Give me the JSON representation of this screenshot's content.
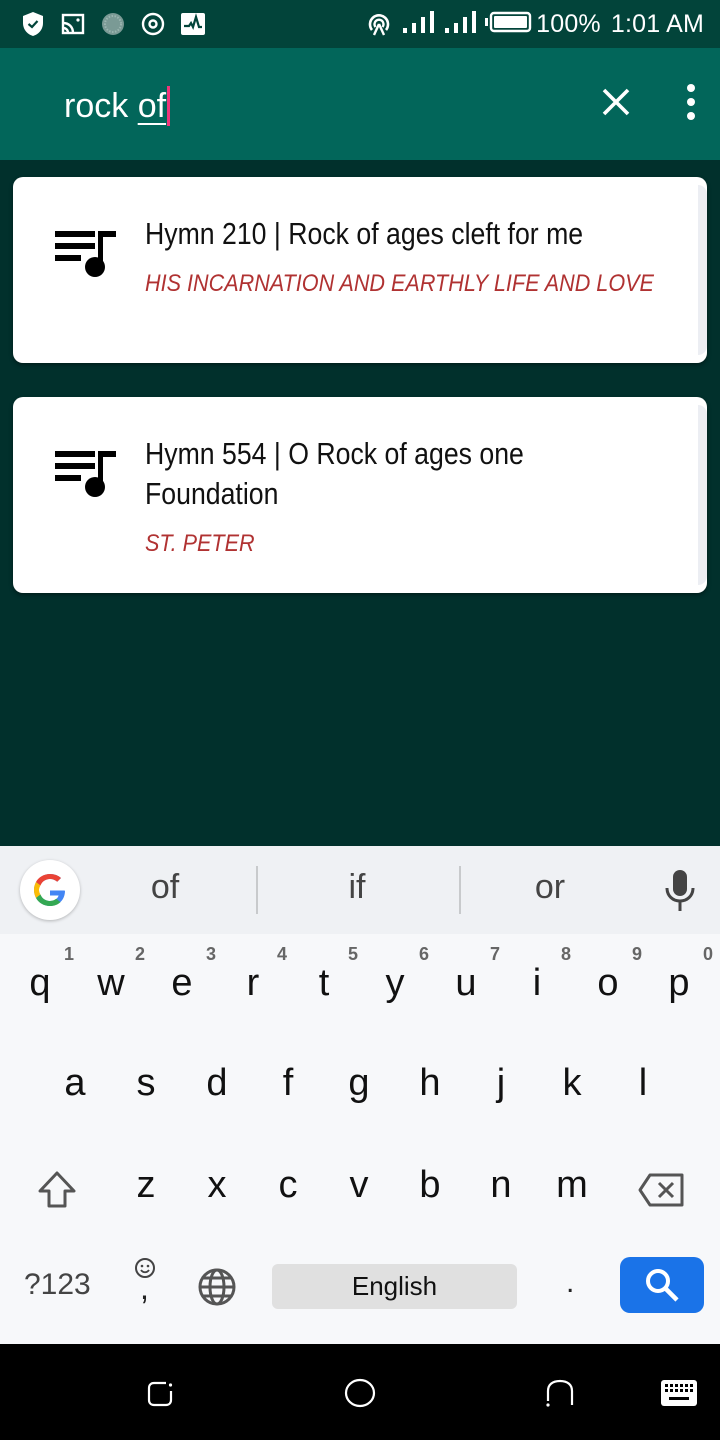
{
  "status_bar": {
    "left_icons": [
      "shield-check-icon",
      "cast-icon",
      "loading-icon",
      "target-icon",
      "activity-icon"
    ],
    "right_icons": [
      "hotspot-icon",
      "signal-icon",
      "signal-icon",
      "battery-icon"
    ],
    "battery": "100%",
    "time": "1:01 AM"
  },
  "search": {
    "query_prefix": "rock ",
    "query_composing": "of",
    "clear_icon": "close-icon",
    "menu_icon": "more-vert-icon"
  },
  "results": [
    {
      "icon": "music-queue-icon",
      "title": "Hymn 210 |  Rock of ages cleft for me",
      "subtitle": "HIS INCARNATION AND EARTHLY LIFE AND LOVE"
    },
    {
      "icon": "music-queue-icon",
      "title": "Hymn 554 | O Rock of ages one Foundation",
      "subtitle": "ST. PETER"
    }
  ],
  "keyboard": {
    "suggestions": [
      "of",
      "if",
      "or"
    ],
    "row1": [
      {
        "key": "q",
        "num": "1"
      },
      {
        "key": "w",
        "num": "2"
      },
      {
        "key": "e",
        "num": "3"
      },
      {
        "key": "r",
        "num": "4"
      },
      {
        "key": "t",
        "num": "5"
      },
      {
        "key": "y",
        "num": "6"
      },
      {
        "key": "u",
        "num": "7"
      },
      {
        "key": "i",
        "num": "8"
      },
      {
        "key": "o",
        "num": "9"
      },
      {
        "key": "p",
        "num": "0"
      }
    ],
    "row2": [
      "a",
      "s",
      "d",
      "f",
      "g",
      "h",
      "j",
      "k",
      "l"
    ],
    "row3": [
      "z",
      "x",
      "c",
      "v",
      "b",
      "n",
      "m"
    ],
    "symbols_label": "?123",
    "comma_label": ",",
    "space_label": "English",
    "period_label": ".",
    "accent_color": "#1a73e8"
  },
  "nav_bar": {
    "buttons": [
      "recents-icon",
      "home-icon",
      "back-icon",
      "keyboard-switch-icon"
    ]
  }
}
